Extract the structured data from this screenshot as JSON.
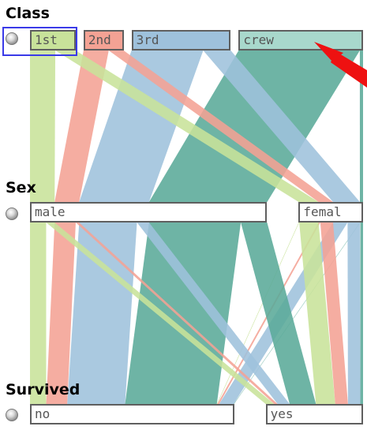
{
  "chart_data": {
    "type": "parallel_sets",
    "dimensions": [
      {
        "name": "Class",
        "categories": [
          "1st",
          "2nd",
          "3rd",
          "crew"
        ],
        "selected": true
      },
      {
        "name": "Sex",
        "categories": [
          "male",
          "femal"
        ],
        "selected": false
      },
      {
        "name": "Survived",
        "categories": [
          "no",
          "yes"
        ],
        "selected": false
      }
    ],
    "colors": {
      "1st": "#c8e29a",
      "2nd": "#f4a294",
      "3rd": "#9ec1dc",
      "crew": "#5aaa98"
    },
    "box_fills": {
      "1st": "#c8e29a",
      "2nd": "#f4a294",
      "3rd": "#9ec1dc",
      "crew": "#a8d8cc",
      "neutral": "#ffffff"
    },
    "flows_class_sex": [
      {
        "class": "1st",
        "sex": "male",
        "count": 180
      },
      {
        "class": "1st",
        "sex": "femal",
        "count": 145
      },
      {
        "class": "2nd",
        "sex": "male",
        "count": 179
      },
      {
        "class": "2nd",
        "sex": "femal",
        "count": 106
      },
      {
        "class": "3rd",
        "sex": "male",
        "count": 510
      },
      {
        "class": "3rd",
        "sex": "femal",
        "count": 196
      },
      {
        "class": "crew",
        "sex": "male",
        "count": 862
      },
      {
        "class": "crew",
        "sex": "femal",
        "count": 23
      }
    ],
    "flows_sex_survived": [
      {
        "class": "1st",
        "sex": "male",
        "survived": "no",
        "count": 118
      },
      {
        "class": "1st",
        "sex": "male",
        "survived": "yes",
        "count": 62
      },
      {
        "class": "2nd",
        "sex": "male",
        "survived": "no",
        "count": 154
      },
      {
        "class": "2nd",
        "sex": "male",
        "survived": "yes",
        "count": 25
      },
      {
        "class": "3rd",
        "sex": "male",
        "survived": "no",
        "count": 422
      },
      {
        "class": "3rd",
        "sex": "male",
        "survived": "yes",
        "count": 88
      },
      {
        "class": "crew",
        "sex": "male",
        "survived": "no",
        "count": 670
      },
      {
        "class": "crew",
        "sex": "male",
        "survived": "yes",
        "count": 192
      },
      {
        "class": "1st",
        "sex": "femal",
        "survived": "no",
        "count": 4
      },
      {
        "class": "1st",
        "sex": "femal",
        "survived": "yes",
        "count": 141
      },
      {
        "class": "2nd",
        "sex": "femal",
        "survived": "no",
        "count": 13
      },
      {
        "class": "2nd",
        "sex": "femal",
        "survived": "yes",
        "count": 93
      },
      {
        "class": "3rd",
        "sex": "femal",
        "survived": "no",
        "count": 106
      },
      {
        "class": "3rd",
        "sex": "femal",
        "survived": "yes",
        "count": 90
      },
      {
        "class": "crew",
        "sex": "femal",
        "survived": "no",
        "count": 3
      },
      {
        "class": "crew",
        "sex": "femal",
        "survived": "yes",
        "count": 20
      }
    ]
  }
}
